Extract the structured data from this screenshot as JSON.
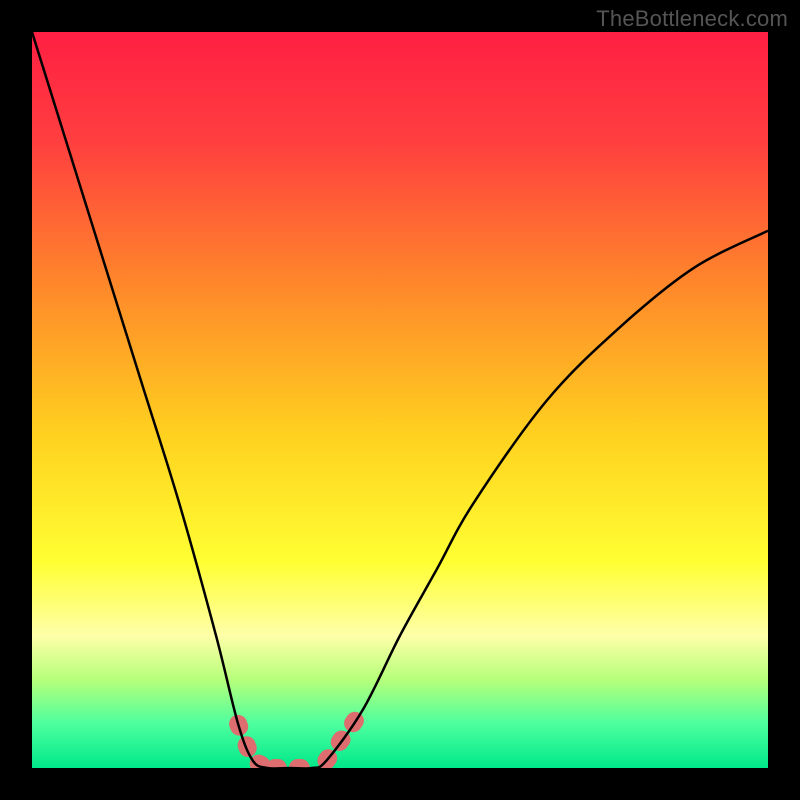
{
  "watermark": "TheBottleneck.com",
  "chart_data": {
    "type": "line",
    "title": "",
    "xlabel": "",
    "ylabel": "",
    "xlim": [
      0,
      100
    ],
    "ylim": [
      0,
      100
    ],
    "series": [
      {
        "name": "bottleneck-curve",
        "x": [
          0,
          5,
          10,
          15,
          20,
          25,
          28,
          30,
          32,
          35,
          38,
          40,
          45,
          50,
          55,
          60,
          70,
          80,
          90,
          100
        ],
        "y": [
          100,
          84,
          68,
          52,
          36,
          18,
          6,
          1,
          0,
          0,
          0,
          1,
          8,
          18,
          27,
          36,
          50,
          60,
          68,
          73
        ]
      }
    ],
    "highlight_segments": [
      {
        "x_start": 28,
        "x_end": 33,
        "note": "left side of valley"
      },
      {
        "x_start": 33,
        "x_end": 38,
        "note": "valley floor"
      },
      {
        "x_start": 40,
        "x_end": 44,
        "note": "right side of valley"
      }
    ],
    "background_gradient": {
      "stops": [
        {
          "offset": 0.0,
          "color": "#ff1f43"
        },
        {
          "offset": 0.15,
          "color": "#ff3f3f"
        },
        {
          "offset": 0.35,
          "color": "#ff8a2a"
        },
        {
          "offset": 0.55,
          "color": "#ffd21f"
        },
        {
          "offset": 0.72,
          "color": "#ffff33"
        },
        {
          "offset": 0.82,
          "color": "#feffa8"
        },
        {
          "offset": 0.88,
          "color": "#b6ff7a"
        },
        {
          "offset": 0.94,
          "color": "#4dff9e"
        },
        {
          "offset": 1.0,
          "color": "#00e88a"
        }
      ]
    },
    "highlight_color": "#dd6d6f"
  }
}
